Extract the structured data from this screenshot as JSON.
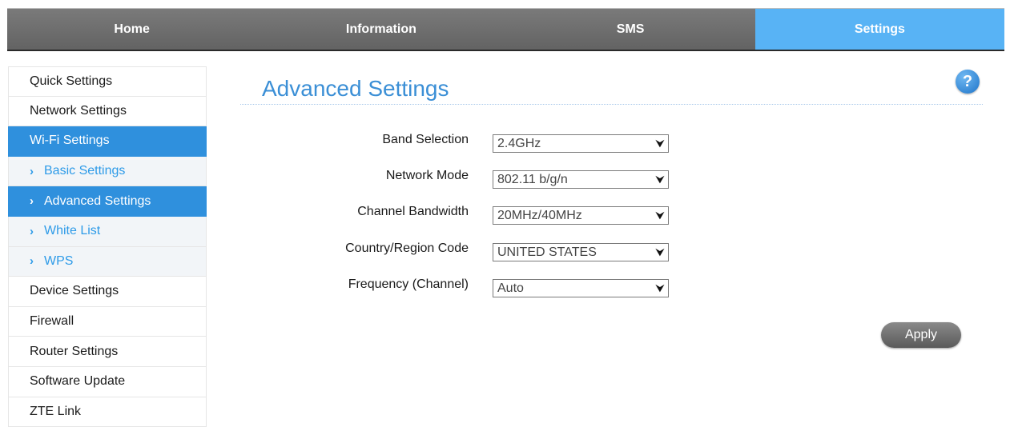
{
  "nav": {
    "tabs": [
      {
        "label": "Home"
      },
      {
        "label": "Information"
      },
      {
        "label": "SMS"
      },
      {
        "label": "Settings"
      }
    ],
    "active_tab": "Settings"
  },
  "sidebar": {
    "items": [
      {
        "label": "Quick Settings"
      },
      {
        "label": "Network Settings"
      },
      {
        "label": "Wi-Fi Settings"
      },
      {
        "label": "Basic Settings"
      },
      {
        "label": "Advanced Settings"
      },
      {
        "label": "White List"
      },
      {
        "label": "WPS"
      },
      {
        "label": "Device Settings"
      },
      {
        "label": "Firewall"
      },
      {
        "label": "Router Settings"
      },
      {
        "label": "Software Update"
      },
      {
        "label": "ZTE Link"
      }
    ],
    "sub_arrow": "›"
  },
  "main": {
    "title": "Advanced Settings",
    "help_icon": "?",
    "fields": [
      {
        "label": "Band Selection",
        "value": "2.4GHz"
      },
      {
        "label": "Network Mode",
        "value": "802.11 b/g/n"
      },
      {
        "label": "Channel Bandwidth",
        "value": "20MHz/40MHz"
      },
      {
        "label": "Country/Region Code",
        "value": "UNITED STATES"
      },
      {
        "label": "Frequency (Channel)",
        "value": "Auto"
      }
    ],
    "apply_label": "Apply"
  },
  "colors": {
    "accent": "#58b3f5",
    "sidebar_active": "#2f90dd",
    "title": "#3b8fd6"
  }
}
